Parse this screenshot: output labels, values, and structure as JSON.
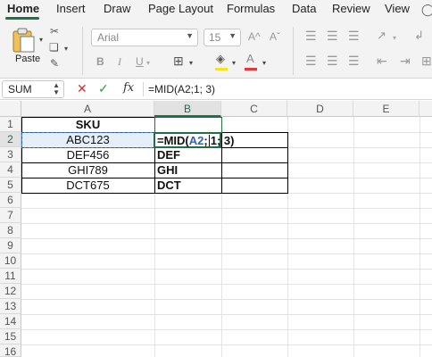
{
  "ribbon_tabs": [
    "Home",
    "Insert",
    "Draw",
    "Page Layout",
    "Formulas",
    "Data",
    "Review",
    "View"
  ],
  "ribbon": {
    "paste_label": "Paste",
    "font_name": "Arial",
    "font_size": "15",
    "bold_label": "B",
    "italic_label": "I",
    "underline_label": "U",
    "grow_font": "A^",
    "shrink_font": "Aˇ"
  },
  "formula_bar": {
    "name_box": "SUM",
    "fx_label": "fx",
    "formula": "=MID(A2;1; 3)"
  },
  "columns": [
    "A",
    "B",
    "C",
    "D",
    "E"
  ],
  "rows": [
    "1",
    "2",
    "3",
    "4",
    "5",
    "6",
    "7",
    "8",
    "9",
    "10",
    "11",
    "12",
    "13",
    "14",
    "15",
    "16"
  ],
  "cells": {
    "A1": "SKU",
    "A2": "ABC123",
    "A3": "DEF456",
    "A4": "GHI789",
    "A5": "DCT675",
    "B3": "DEF",
    "B4": "GHI",
    "B5": "DCT"
  },
  "editing": {
    "cell": "B2",
    "prefix": "=MID(",
    "ref": "A2",
    "suffix_before_caret": ";",
    "suffix_after_caret": "1; 3)"
  },
  "colors": {
    "accent": "#1e7145",
    "ref_blue": "#2f5fc4",
    "cancel_red": "#d9302b",
    "enter_green": "#2e9c48"
  }
}
